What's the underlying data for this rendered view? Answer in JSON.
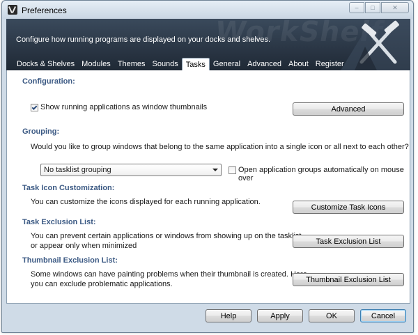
{
  "window": {
    "title": "Preferences",
    "controls": {
      "minimize": "–",
      "maximize": "□",
      "close": "✕"
    }
  },
  "banner": {
    "description": "Configure how running programs are displayed on your docks and shelves.",
    "watermark": "WorkShelf"
  },
  "tabs": [
    {
      "label": "Docks & Shelves",
      "active": false
    },
    {
      "label": "Modules",
      "active": false
    },
    {
      "label": "Themes",
      "active": false
    },
    {
      "label": "Sounds",
      "active": false
    },
    {
      "label": "Tasks",
      "active": true
    },
    {
      "label": "General",
      "active": false
    },
    {
      "label": "Advanced",
      "active": false
    },
    {
      "label": "About",
      "active": false
    },
    {
      "label": "Register",
      "active": false
    }
  ],
  "configuration": {
    "title": "Configuration:",
    "thumbnails_label": "Show running applications as window thumbnails",
    "thumbnails_checked": true,
    "advanced_button": "Advanced"
  },
  "grouping": {
    "title": "Grouping:",
    "question": "Would you like to group windows that belong to the same application into a single icon or all next to each other?",
    "selected": "No tasklist grouping",
    "open_groups_label": "Open application groups automatically on mouse over",
    "open_groups_checked": false
  },
  "task_icon": {
    "title": "Task Icon Customization:",
    "description": "You can customize the icons displayed for each running application.",
    "button": "Customize Task Icons"
  },
  "task_exclusion": {
    "title": "Task Exclusion List:",
    "line1": "You can prevent certain applications or windows from showing up on the tasklist",
    "line2": "or appear only when minimized",
    "button": "Task Exclusion List"
  },
  "thumb_exclusion": {
    "title": "Thumbnail Exclusion List:",
    "line1": "Some windows can have painting problems when their thumbnail is created. Here",
    "line2": "you can exclude problematic applications.",
    "button": "Thumbnail Exclusion List"
  },
  "footer": {
    "help": "Help",
    "apply": "Apply",
    "ok": "OK",
    "cancel": "Cancel"
  }
}
